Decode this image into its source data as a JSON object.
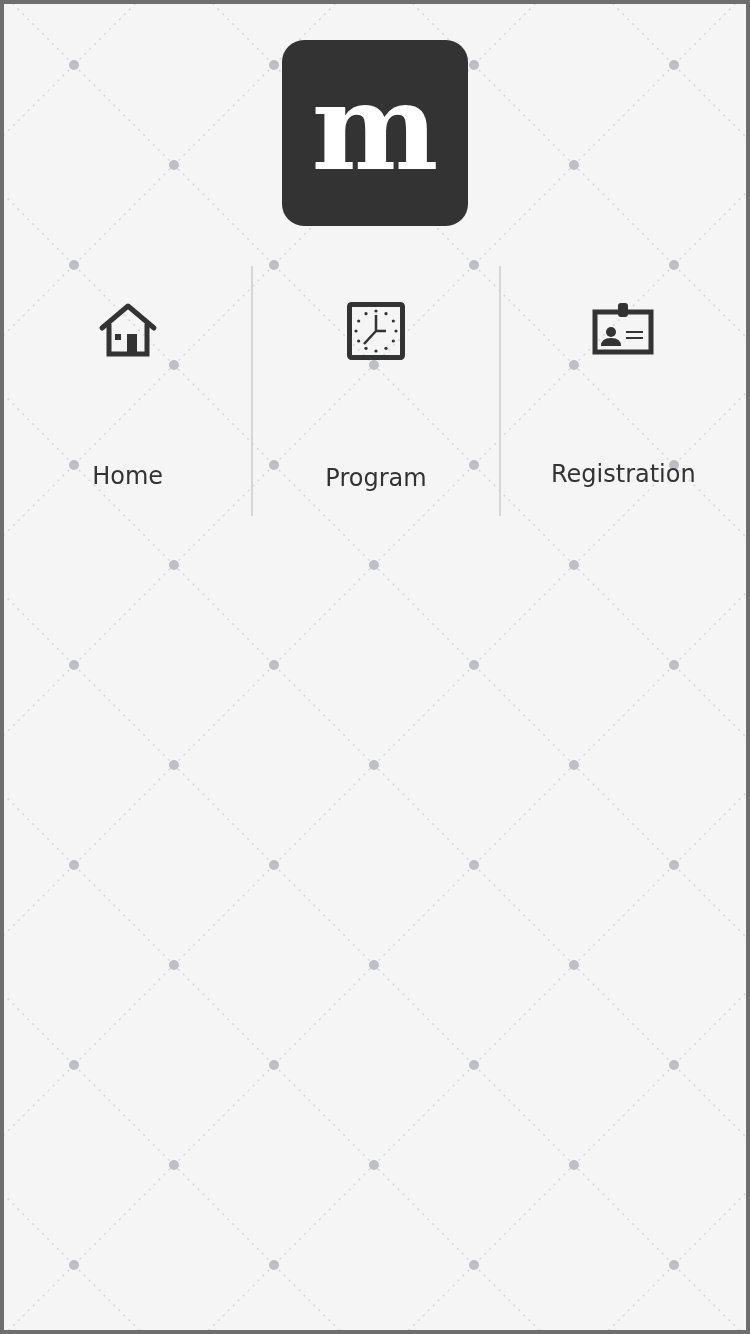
{
  "logo": {
    "letter": "m"
  },
  "nav": [
    {
      "kind": "home",
      "label": "Home"
    },
    {
      "kind": "clock",
      "label": "Program"
    },
    {
      "kind": "badge",
      "label": "Registration"
    }
  ]
}
